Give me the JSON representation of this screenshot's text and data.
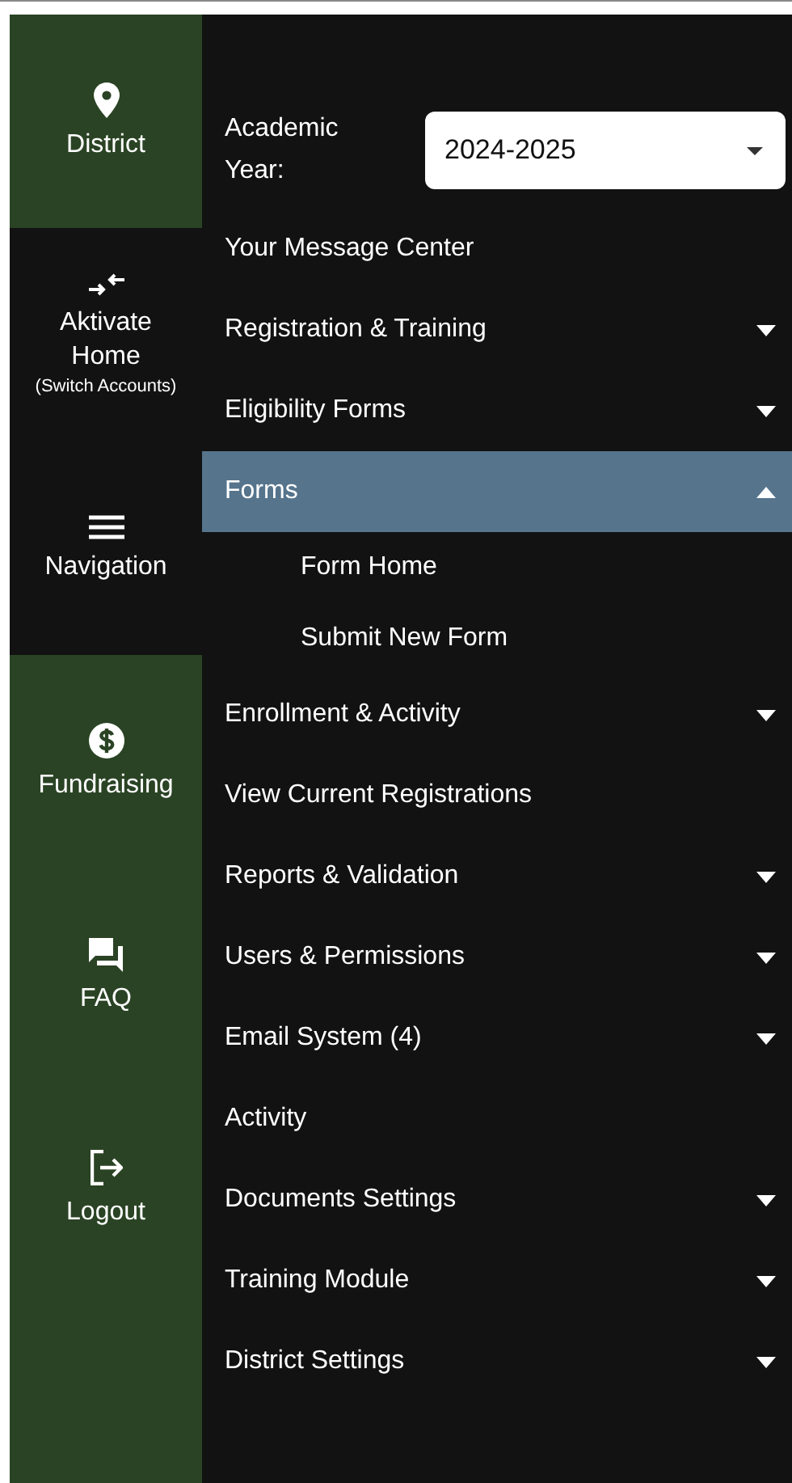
{
  "rail": [
    {
      "label": "District",
      "kind": "pin",
      "highlighted": true
    },
    {
      "label": "Aktivate Home",
      "sublabel": "(Switch Accounts)",
      "kind": "switch",
      "highlighted": false
    },
    {
      "label": "Navigation",
      "kind": "menu",
      "highlighted": false
    },
    {
      "label": "Fundraising",
      "kind": "dollar",
      "highlighted": true
    },
    {
      "label": "FAQ",
      "kind": "chat",
      "highlighted": true
    },
    {
      "label": "Logout",
      "kind": "logout",
      "highlighted": true
    }
  ],
  "year": {
    "label": "Academic Year:",
    "value": "2024-2025"
  },
  "menu": [
    {
      "label": "Your Message Center",
      "kind": "link",
      "selected": false
    },
    {
      "label": "Registration & Training",
      "kind": "group",
      "expanded": false,
      "selected": false
    },
    {
      "label": "Eligibility Forms",
      "kind": "group",
      "expanded": false,
      "selected": false
    },
    {
      "label": "Forms",
      "kind": "group",
      "expanded": true,
      "selected": true,
      "children": [
        {
          "label": "Form Home"
        },
        {
          "label": "Submit New Form"
        }
      ]
    },
    {
      "label": "Enrollment & Activity",
      "kind": "group",
      "expanded": false,
      "selected": false
    },
    {
      "label": "View Current Registrations",
      "kind": "link",
      "selected": false
    },
    {
      "label": "Reports & Validation",
      "kind": "group",
      "expanded": false,
      "selected": false
    },
    {
      "label": "Users & Permissions",
      "kind": "group",
      "expanded": false,
      "selected": false
    },
    {
      "label": "Email System (4)",
      "kind": "group",
      "expanded": false,
      "selected": false
    },
    {
      "label": "Activity",
      "kind": "link",
      "selected": false
    },
    {
      "label": "Documents Settings",
      "kind": "group",
      "expanded": false,
      "selected": false
    },
    {
      "label": "Training Module",
      "kind": "group",
      "expanded": false,
      "selected": false
    },
    {
      "label": "District Settings",
      "kind": "group",
      "expanded": false,
      "selected": false
    }
  ]
}
